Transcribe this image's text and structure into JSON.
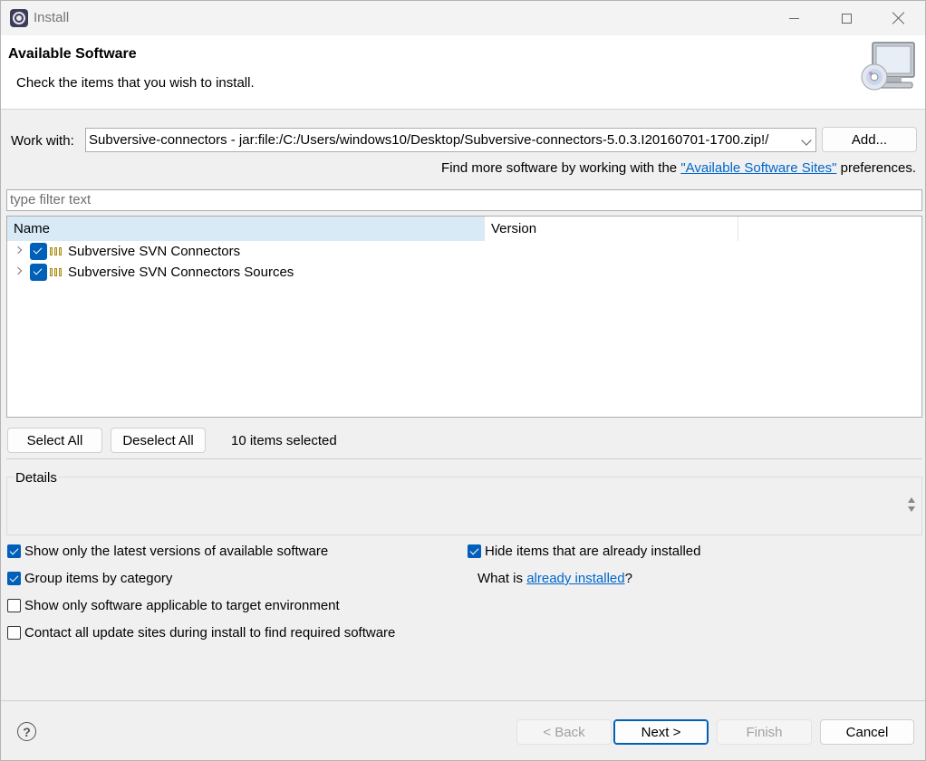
{
  "window": {
    "title": "Install"
  },
  "banner": {
    "title": "Available Software",
    "subtitle": "Check the items that you wish to install."
  },
  "work_with": {
    "label": "Work with:",
    "value": "Subversive-connectors - jar:file:/C:/Users/windows10/Desktop/Subversive-connectors-5.0.3.I20160701-1700.zip!/",
    "add_label": "Add...",
    "more_prefix": "Find more software by working with the ",
    "more_link": "\"Available Software Sites\"",
    "more_suffix": " preferences."
  },
  "filter": {
    "placeholder": "type filter text"
  },
  "tree": {
    "columns": [
      "Name",
      "Version"
    ],
    "rows": [
      {
        "label": "Subversive SVN Connectors",
        "checked": true
      },
      {
        "label": "Subversive SVN Connectors Sources",
        "checked": true
      }
    ]
  },
  "selection": {
    "select_all": "Select All",
    "deselect_all": "Deselect All",
    "status": "10 items selected"
  },
  "details": {
    "label": "Details"
  },
  "options": {
    "latest_versions": {
      "label": "Show only the latest versions of available software",
      "checked": true
    },
    "group_by_category": {
      "label": "Group items by category",
      "checked": true
    },
    "target_env": {
      "label": "Show only software applicable to target environment",
      "checked": false
    },
    "contact_sites": {
      "label": "Contact all update sites during install to find required software",
      "checked": false
    },
    "hide_installed": {
      "label": "Hide items that are already installed",
      "checked": true
    },
    "what_is_prefix": "What is ",
    "what_is_link": "already installed",
    "what_is_suffix": "?"
  },
  "footer": {
    "help": "?",
    "back": "< Back",
    "next": "Next >",
    "finish": "Finish",
    "cancel": "Cancel"
  },
  "colors": {
    "accent": "#005fb8",
    "link": "#0066cc",
    "header_selected": "#d9eaf7"
  }
}
